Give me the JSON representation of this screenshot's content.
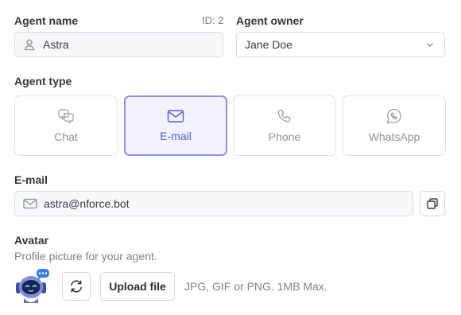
{
  "agent_name": {
    "label": "Agent name",
    "id_label": "ID: 2",
    "value": "Astra",
    "icon": "user-icon"
  },
  "agent_owner": {
    "label": "Agent owner",
    "selected": "Jane Doe",
    "icon": "chevron-down-icon"
  },
  "agent_type": {
    "label": "Agent type",
    "options": [
      {
        "label": "Chat",
        "icon": "chat-icon",
        "selected": false
      },
      {
        "label": "E-mail",
        "icon": "mail-icon",
        "selected": true
      },
      {
        "label": "Phone",
        "icon": "phone-icon",
        "selected": false
      },
      {
        "label": "WhatsApp",
        "icon": "whatsapp-icon",
        "selected": false
      }
    ]
  },
  "email": {
    "label": "E-mail",
    "value": "astra@nforce.bot",
    "icon": "mail-icon",
    "copy_icon": "copy-icon"
  },
  "avatar": {
    "label": "Avatar",
    "description": "Profile picture for your agent.",
    "upload_label": "Upload file",
    "hint": "JPG, GIF or PNG. 1MB Max.",
    "refresh_icon": "refresh-icon"
  },
  "colors": {
    "accent": "#5659e2",
    "accent_border": "#8d8ff1",
    "accent_bg": "#f3f3ff",
    "text": "#2a2d33",
    "muted": "#7c828c",
    "border": "#d9dce1"
  }
}
